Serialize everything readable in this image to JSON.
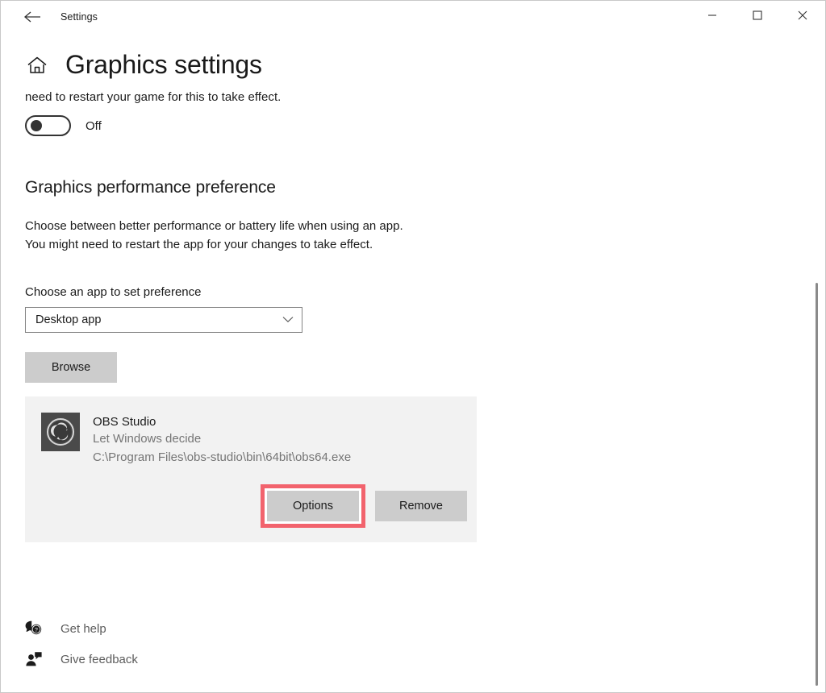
{
  "titlebar": {
    "back_icon": "back-arrow-icon",
    "title": "Settings",
    "minimize_icon": "minimize-icon",
    "maximize_icon": "maximize-icon",
    "close_icon": "close-icon"
  },
  "page": {
    "home_icon": "home-icon",
    "title": "Graphics settings",
    "clipped_text": "need to restart your game for this to take effect.",
    "toggle": {
      "state": "Off",
      "checked": false
    }
  },
  "performance": {
    "section_title": "Graphics performance preference",
    "description_line1": "Choose between better performance or battery life when using an app.",
    "description_line2": "You might need to restart the app for your changes to take effect.",
    "field_label": "Choose an app to set preference",
    "dropdown": {
      "value": "Desktop app",
      "arrow_icon": "chevron-down-icon"
    },
    "browse_label": "Browse"
  },
  "app_entry": {
    "icon_name": "obs-studio-icon",
    "name": "OBS Studio",
    "preference": "Let Windows decide",
    "path": "C:\\Program Files\\obs-studio\\bin\\64bit\\obs64.exe",
    "options_label": "Options",
    "remove_label": "Remove",
    "highlight_color": "#f2636d"
  },
  "footer": {
    "links": [
      {
        "icon": "help-bubble-icon",
        "label": "Get help"
      },
      {
        "icon": "feedback-person-icon",
        "label": "Give feedback"
      }
    ]
  },
  "colors": {
    "card_background": "#f2f2f2",
    "button_background": "#cccccc",
    "muted_text": "#757575",
    "highlight": "#f2636d"
  }
}
